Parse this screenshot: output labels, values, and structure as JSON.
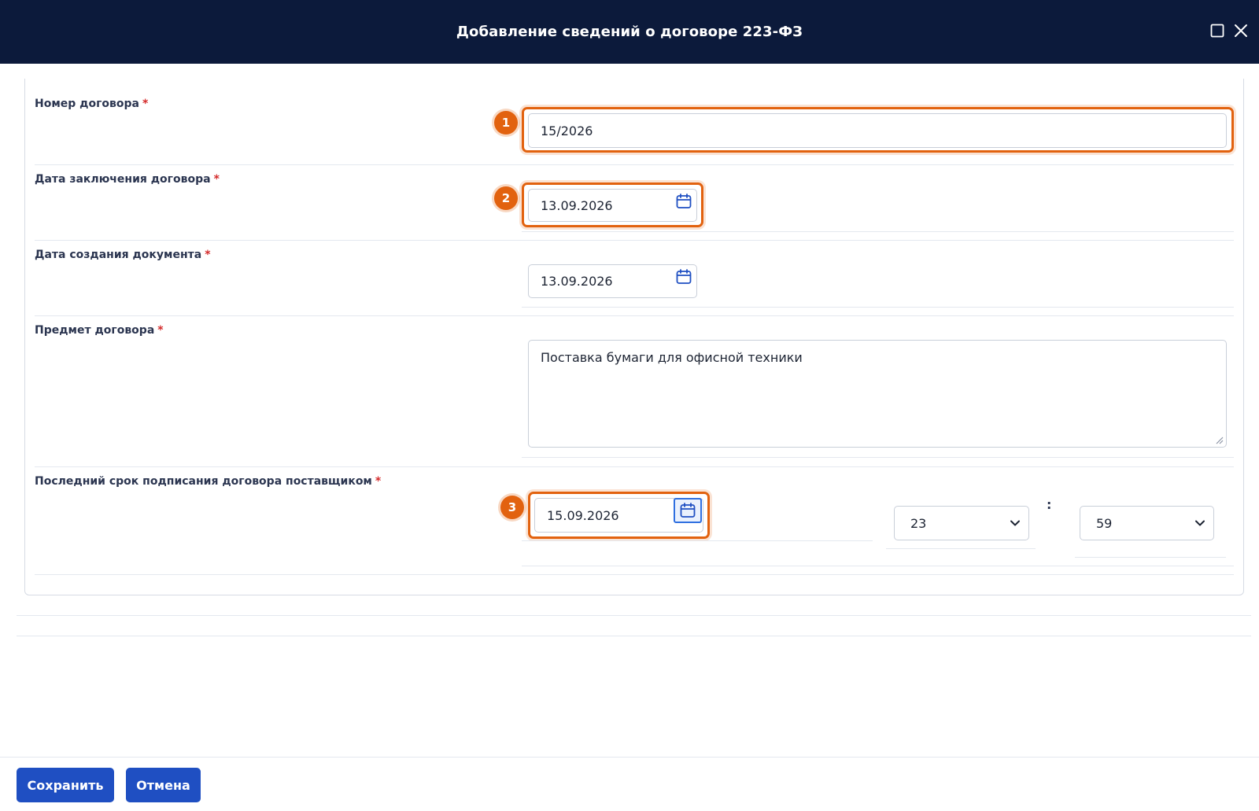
{
  "dialog": {
    "title": "Добавление сведений о договоре 223-ФЗ",
    "icons": {
      "maximize": "maximize-icon",
      "close": "close-icon"
    }
  },
  "form": {
    "contract_number": {
      "label": "Номер договора",
      "required_mark": "*",
      "value": "15/2026",
      "marker": "1"
    },
    "conclusion_date": {
      "label": "Дата заключения договора",
      "required_mark": "*",
      "value": "13.09.2026",
      "marker": "2"
    },
    "creation_date": {
      "label": "Дата создания документа",
      "required_mark": "*",
      "value": "13.09.2026"
    },
    "subject": {
      "label": "Предмет договора",
      "required_mark": "*",
      "value": "Поставка бумаги для офисной техники"
    },
    "signing_deadline": {
      "label": "Последний срок подписания договора поставщиком",
      "required_mark": "*",
      "date": "15.09.2026",
      "marker": "3",
      "hour": "23",
      "separator": ":",
      "minute": "59"
    }
  },
  "footer": {
    "save_label": "Сохранить",
    "cancel_label": "Отмена"
  },
  "colors": {
    "header_bg": "#0c1a3b",
    "accent": "#1f4fc2",
    "highlight": "#e2620f",
    "required": "#d42a2a"
  }
}
